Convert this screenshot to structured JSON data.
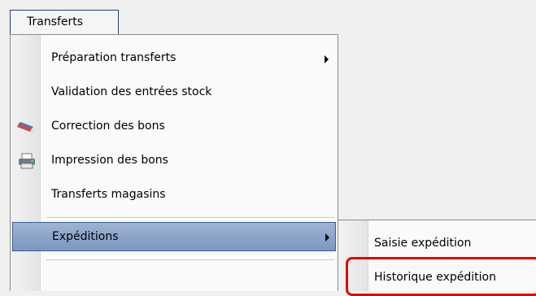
{
  "menubar": {
    "title": "Transferts",
    "title_mnemonic": "r"
  },
  "menu": {
    "items": [
      {
        "label": "Préparation transferts",
        "has_submenu": true,
        "icon": ""
      },
      {
        "label": "Validation des entrées stock",
        "has_submenu": false,
        "icon": ""
      },
      {
        "label": "Correction des bons",
        "has_submenu": false,
        "icon": "pen-eraser-icon"
      },
      {
        "label": "Impression des bons",
        "has_submenu": false,
        "icon": "printer-icon"
      },
      {
        "label": "Transferts magasins",
        "has_submenu": false,
        "icon": ""
      },
      {
        "label": "Expéditions",
        "has_submenu": true,
        "icon": "",
        "selected": true
      }
    ]
  },
  "submenu": {
    "items": [
      {
        "label": "Saisie expédition"
      },
      {
        "label": "Historique expédition",
        "highlighted": true
      }
    ]
  },
  "colors": {
    "selected_bg": "#8aa3cc",
    "highlight_border": "#e60000",
    "menu_border": "#8a8a8a"
  }
}
